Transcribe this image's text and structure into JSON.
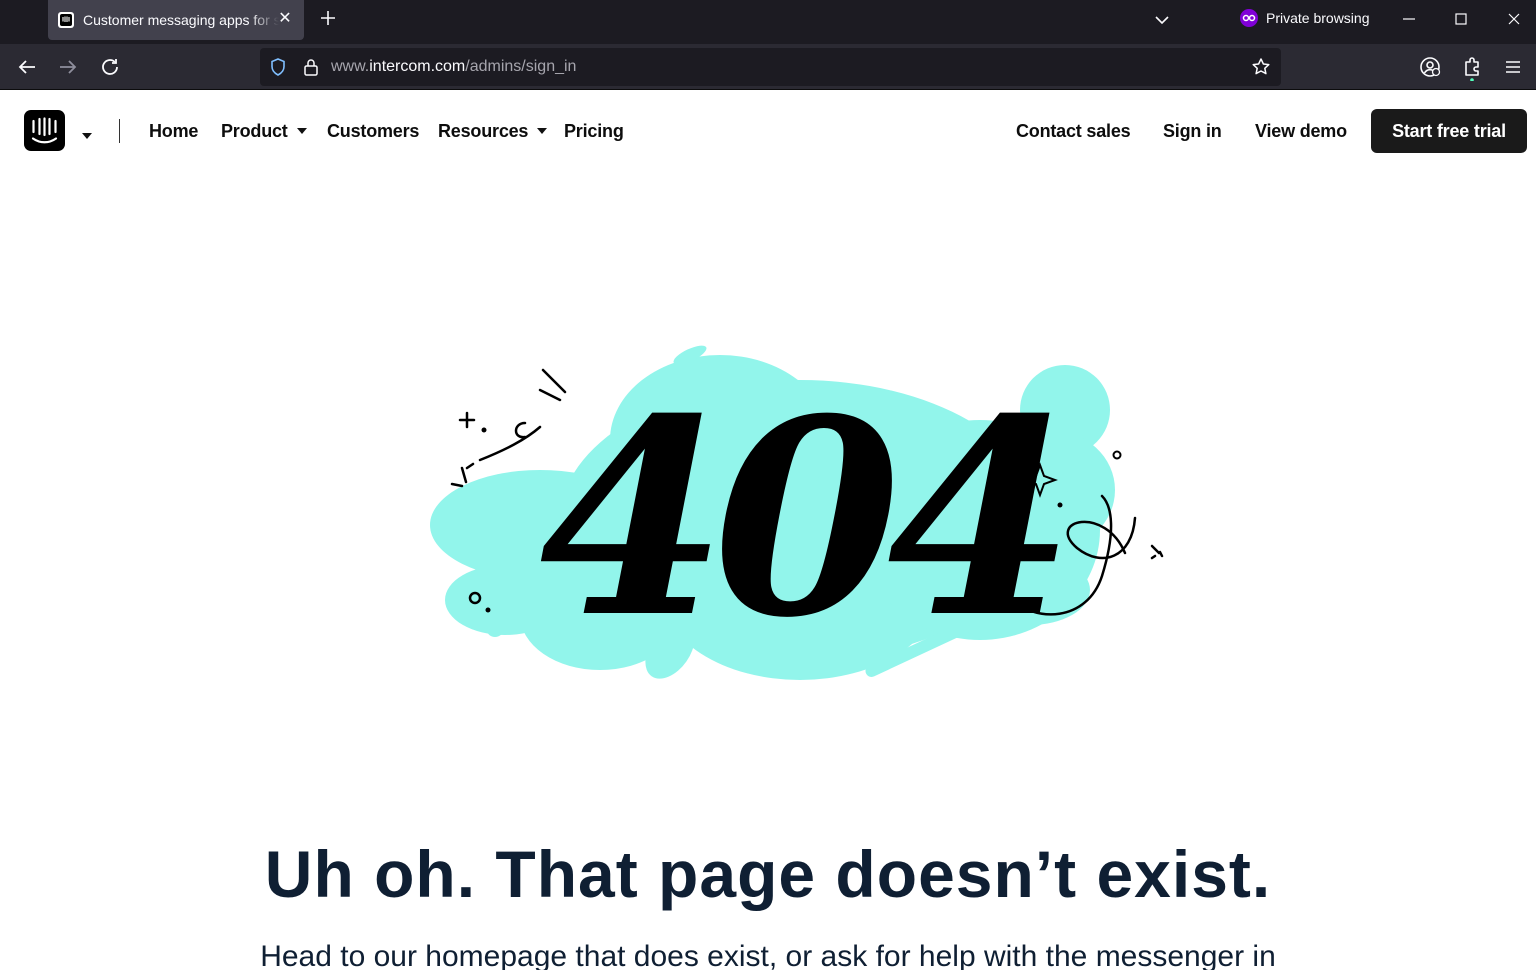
{
  "browser": {
    "tab_title": "Customer messaging apps for sales, marketing, and support | Intercom",
    "new_tab_icon": "plus-icon",
    "private_label": "Private browsing",
    "url_prefix": "www.",
    "url_host": "intercom.com",
    "url_path": "/admins/sign_in"
  },
  "header": {
    "nav": {
      "home": "Home",
      "product": "Product",
      "customers": "Customers",
      "resources": "Resources",
      "pricing": "Pricing"
    },
    "contact_sales": "Contact sales",
    "sign_in": "Sign in",
    "view_demo": "View demo",
    "start_trial": "Start free trial"
  },
  "illustration": {
    "text": "404",
    "accent_color": "#92f5eb"
  },
  "content": {
    "headline": "Uh oh. That page doesn’t exist.",
    "subtext": "Head to our homepage that does exist, or ask for help with the messenger in"
  }
}
